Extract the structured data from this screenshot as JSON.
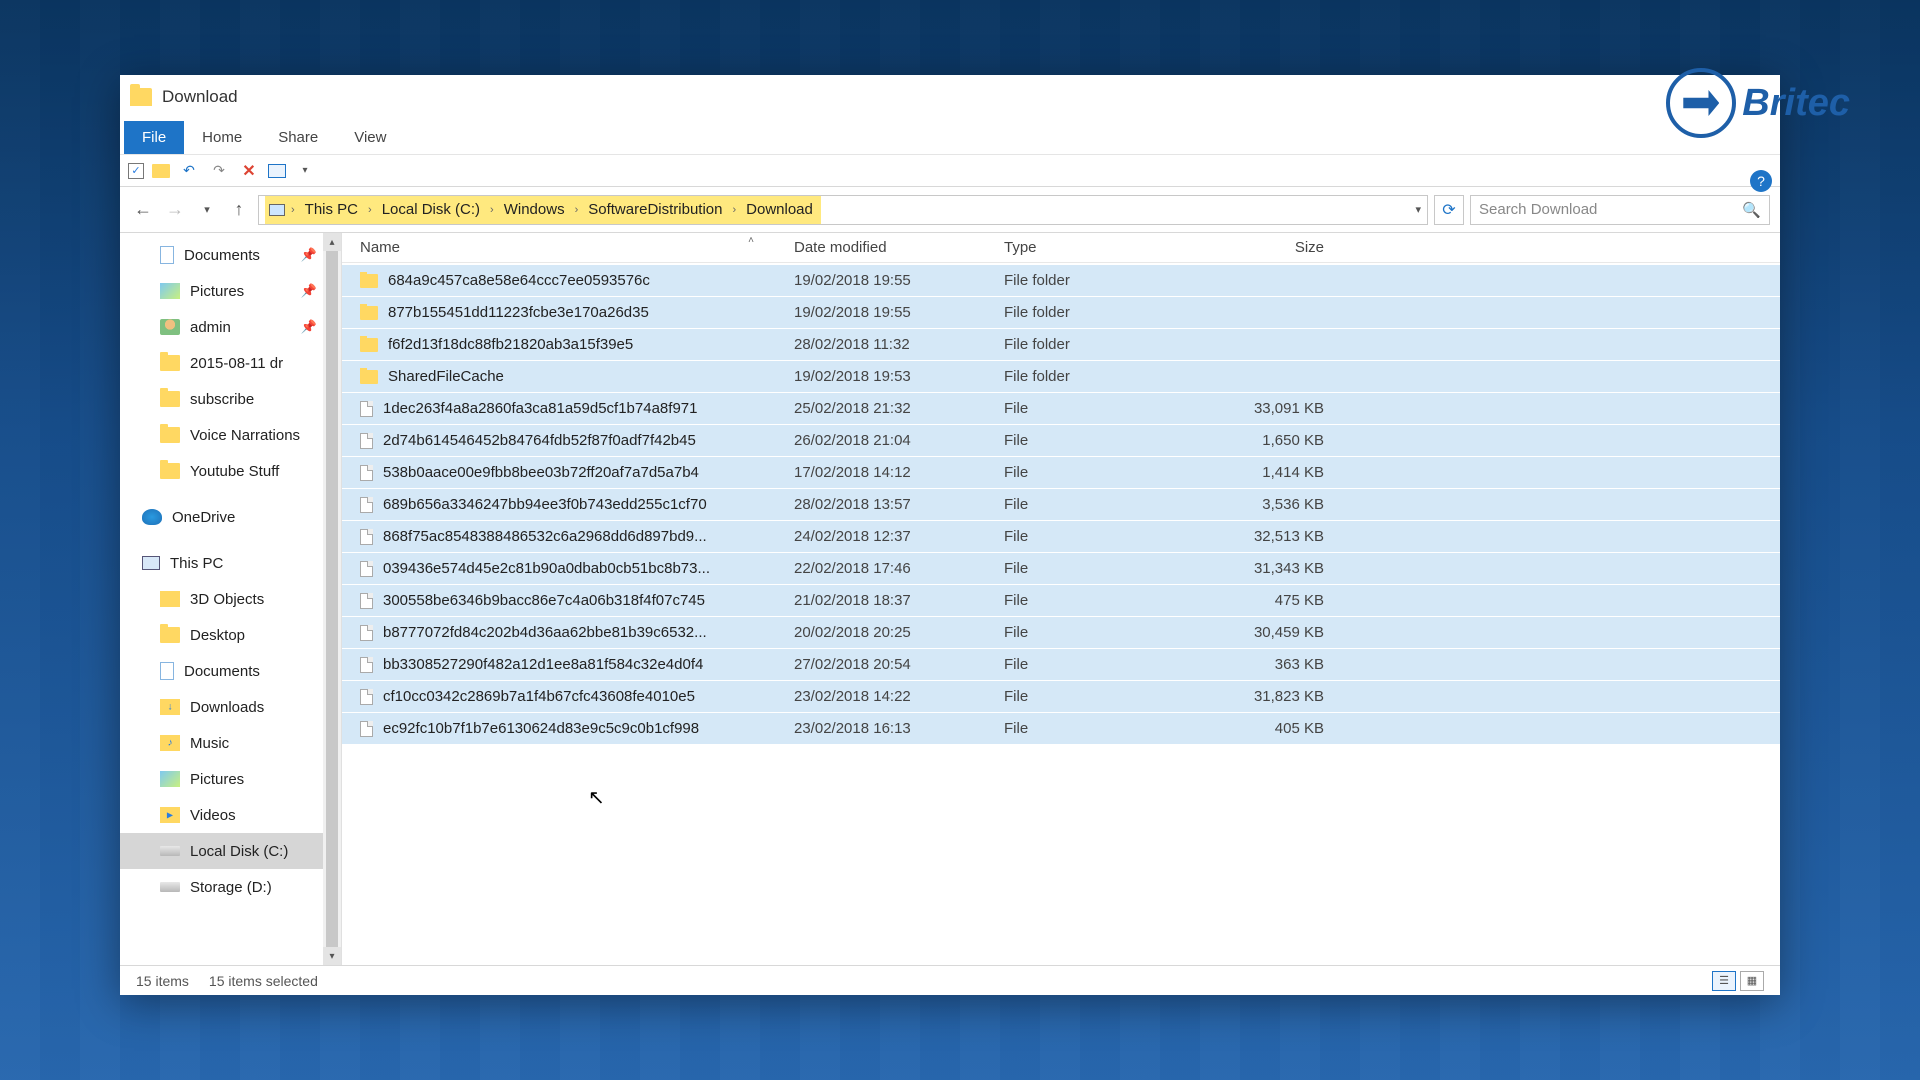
{
  "window": {
    "title": "Download"
  },
  "ribbon": {
    "file": "File",
    "home": "Home",
    "share": "Share",
    "view": "View"
  },
  "breadcrumb": {
    "root": "This PC",
    "c": "Local Disk (C:)",
    "win": "Windows",
    "sd": "SoftwareDistribution",
    "dl": "Download"
  },
  "search": {
    "placeholder": "Search Download"
  },
  "sidebar": {
    "documents_q": "Documents",
    "pictures_q": "Pictures",
    "admin": "admin",
    "date_folder": "2015-08-11 dr",
    "subscribe": "subscribe",
    "voice": "Voice Narrations",
    "youtube": "Youtube Stuff",
    "onedrive": "OneDrive",
    "thispc": "This PC",
    "objects3d": "3D Objects",
    "desktop": "Desktop",
    "documents": "Documents",
    "downloads": "Downloads",
    "music": "Music",
    "pictures": "Pictures",
    "videos": "Videos",
    "localdisk": "Local Disk (C:)",
    "storage": "Storage (D:)"
  },
  "columns": {
    "name": "Name",
    "date": "Date modified",
    "type": "Type",
    "size": "Size"
  },
  "types": {
    "folder": "File folder",
    "file": "File"
  },
  "files": [
    {
      "name": "684a9c457ca8e58e64ccc7ee0593576c",
      "date": "19/02/2018 19:55",
      "type": "folder",
      "size": ""
    },
    {
      "name": "877b155451dd11223fcbe3e170a26d35",
      "date": "19/02/2018 19:55",
      "type": "folder",
      "size": ""
    },
    {
      "name": "f6f2d13f18dc88fb21820ab3a15f39e5",
      "date": "28/02/2018 11:32",
      "type": "folder",
      "size": ""
    },
    {
      "name": "SharedFileCache",
      "date": "19/02/2018 19:53",
      "type": "folder",
      "size": ""
    },
    {
      "name": "1dec263f4a8a2860fa3ca81a59d5cf1b74a8f971",
      "date": "25/02/2018 21:32",
      "type": "file",
      "size": "33,091 KB"
    },
    {
      "name": "2d74b614546452b84764fdb52f87f0adf7f42b45",
      "date": "26/02/2018 21:04",
      "type": "file",
      "size": "1,650 KB"
    },
    {
      "name": "538b0aace00e9fbb8bee03b72ff20af7a7d5a7b4",
      "date": "17/02/2018 14:12",
      "type": "file",
      "size": "1,414 KB"
    },
    {
      "name": "689b656a3346247bb94ee3f0b743edd255c1cf70",
      "date": "28/02/2018 13:57",
      "type": "file",
      "size": "3,536 KB"
    },
    {
      "name": "868f75ac8548388486532c6a2968dd6d897bd9...",
      "date": "24/02/2018 12:37",
      "type": "file",
      "size": "32,513 KB"
    },
    {
      "name": "039436e574d45e2c81b90a0dbab0cb51bc8b73...",
      "date": "22/02/2018 17:46",
      "type": "file",
      "size": "31,343 KB"
    },
    {
      "name": "300558be6346b9bacc86e7c4a06b318f4f07c745",
      "date": "21/02/2018 18:37",
      "type": "file",
      "size": "475 KB"
    },
    {
      "name": "b8777072fd84c202b4d36aa62bbe81b39c6532...",
      "date": "20/02/2018 20:25",
      "type": "file",
      "size": "30,459 KB"
    },
    {
      "name": "bb3308527290f482a12d1ee8a81f584c32e4d0f4",
      "date": "27/02/2018 20:54",
      "type": "file",
      "size": "363 KB"
    },
    {
      "name": "cf10cc0342c2869b7a1f4b67cfc43608fe4010e5",
      "date": "23/02/2018 14:22",
      "type": "file",
      "size": "31,823 KB"
    },
    {
      "name": "ec92fc10b7f1b7e6130624d83e9c5c9c0b1cf998",
      "date": "23/02/2018 16:13",
      "type": "file",
      "size": "405 KB"
    }
  ],
  "status": {
    "count": "15 items",
    "selected": "15 items selected"
  },
  "logo_text": "Britec"
}
